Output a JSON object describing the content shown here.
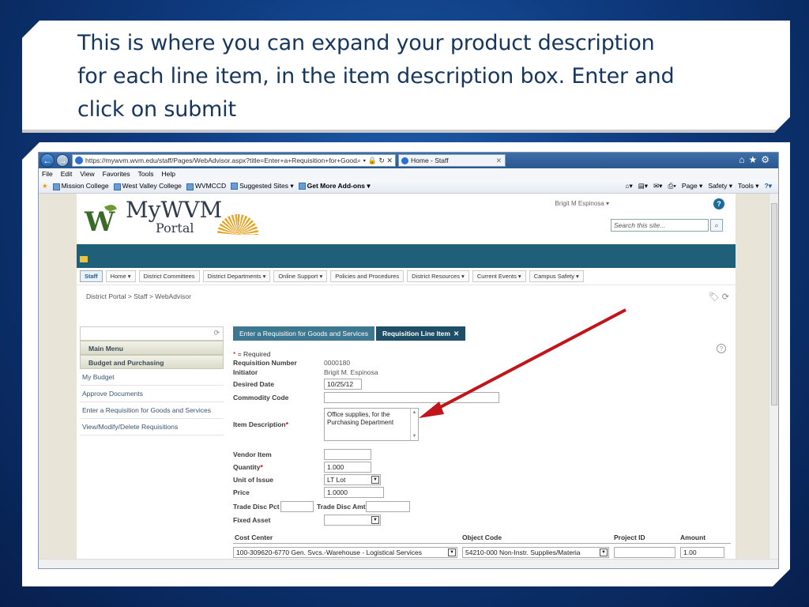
{
  "caption": {
    "line1": "This is where you can expand your product description",
    "line2": "for each line item, in the item description box. Enter and",
    "line3": "click on submit"
  },
  "browser": {
    "address": "https://mywvm.wvm.edu/staff/Pages/WebAdvisor.aspx?title=Enter+a+Requisition+for+Good",
    "address_controls": "⌕ ▾ 🔒 ↻ ✕",
    "tab_title": "Home - Staff",
    "menu": [
      "File",
      "Edit",
      "View",
      "Favorites",
      "Tools",
      "Help"
    ],
    "favorites": [
      "Mission College",
      "West Valley College",
      "WVMCCD",
      "Suggested Sites ▾",
      "Get More Add-ons ▾"
    ],
    "command_bar": [
      "Page ▾",
      "Safety ▾",
      "Tools ▾"
    ]
  },
  "portal": {
    "logo_w": "W",
    "logo_main": "MyWVM",
    "logo_sub": "Portal",
    "user": "Brigit M Espinosa  ▾",
    "help": "?",
    "search_placeholder": "Search this site...",
    "nav": [
      "Staff",
      "Home ▾",
      "District Committees",
      "District Departments ▾",
      "Online Support ▾",
      "Policies and Procedures",
      "District Resources ▾",
      "Current Events ▾",
      "Campus Safety ▾"
    ],
    "breadcrumb": "District Portal >  Staff >  WebAdvisor"
  },
  "sidebar": {
    "main_menu": "Main Menu",
    "section": "Budget and Purchasing",
    "links": [
      "My Budget",
      "Approve Documents",
      "Enter a Requisition for Goods and Services",
      "View/Modify/Delete Requisitions"
    ]
  },
  "form": {
    "tabs": [
      "Enter a Requisition for Goods and Services",
      "Requisition Line Item"
    ],
    "required_note": "= Required",
    "labels": {
      "req_number": "Requisition Number",
      "initiator": "Initiator",
      "desired_date": "Desired Date",
      "commodity": "Commodity Code",
      "item_desc": "Item Description",
      "vendor_item": "Vendor Item",
      "quantity": "Quantity",
      "unit": "Unit of Issue",
      "price": "Price",
      "trade_pct": "Trade Disc Pct",
      "trade_amt": "Trade Disc Amt",
      "fixed_asset": "Fixed Asset"
    },
    "values": {
      "req_number": "0000180",
      "initiator": "Brigit M. Espinosa",
      "desired_date": "10/25/12",
      "item_desc": "Office supplies, for the Purchasing Department",
      "quantity": "1.000",
      "unit": "LT Lot",
      "price": "1.0000"
    },
    "cc_headers": [
      "Cost Center",
      "Object Code",
      "Project ID",
      "Amount"
    ],
    "cc_row": {
      "cost_center": "100-309620-6770 Gen. Svcs.-Warehouse - Logistical Services",
      "object_code": "54210-000 Non-Instr. Supplies/Materia",
      "amount": "1.00"
    }
  },
  "colors": {
    "accent_teal": "#1f5f79",
    "arrow": "#c0151b",
    "caption_text": "#17365d"
  }
}
